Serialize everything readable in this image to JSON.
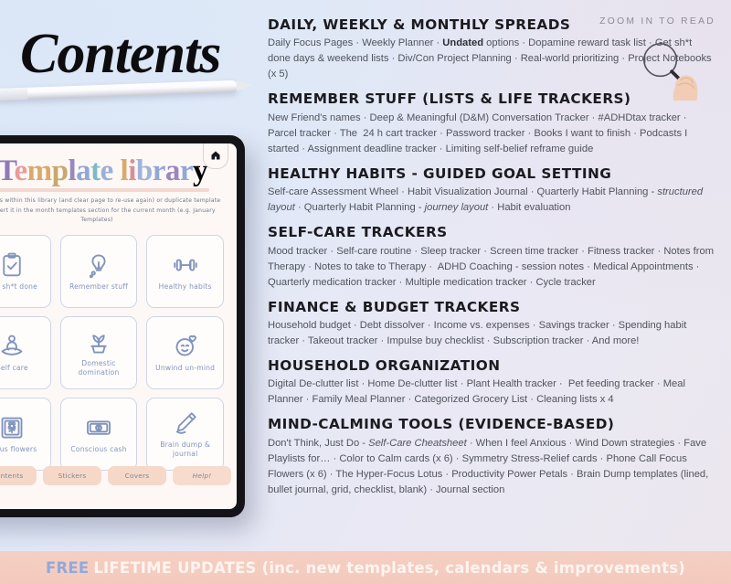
{
  "hero": {
    "title": "Contents"
  },
  "zoom_hint": "ZOOM IN TO READ",
  "tablet": {
    "home_icon": "home-icon",
    "library_title": "Template library",
    "library_title_letters": [
      "T",
      "e",
      "m",
      "p",
      "l",
      "a",
      "t",
      "e",
      " ",
      "l",
      "i",
      "b",
      "r",
      "a",
      "r",
      "y"
    ],
    "description": "templates within this library (and clear page to re-use again) or duplicate template and insert it in the month templates section for the current month (e.g. January Templates)",
    "cards": [
      {
        "label": "Get sh*t done",
        "icon": "clipboard-check-icon"
      },
      {
        "label": "Remember stuff",
        "icon": "lightbulb-thought-icon"
      },
      {
        "label": "Healthy habits",
        "icon": "dumbbell-icon"
      },
      {
        "label": "Self care",
        "icon": "meditation-icon"
      },
      {
        "label": "Domestic domination",
        "icon": "potted-plant-icon"
      },
      {
        "label": "Unwind un-mind",
        "icon": "smiley-heart-icon"
      },
      {
        "label": "Focus flowers",
        "icon": "framed-flower-icon"
      },
      {
        "label": "Conscious cash",
        "icon": "banknote-icon"
      },
      {
        "label": "Brain dump & journal",
        "icon": "pencil-icon"
      }
    ],
    "nav_buttons": [
      {
        "label": "Contents"
      },
      {
        "label": "Stickers"
      },
      {
        "label": "Covers"
      },
      {
        "label": "Help!"
      }
    ]
  },
  "sections": [
    {
      "heading": "DAILY, WEEKLY & MONTHLY SPREADS",
      "body_html": "Daily Focus Pages · Weekly Planner · <b>Undated</b> options · Dopamine reward task list · Get sh*t done days &amp; weekend lists · Div/Con Project Planning · Real-world prioritizing · Project Notebooks (x 5)"
    },
    {
      "heading": "REMEMBER STUFF (LISTS & LIFE TRACKERS)",
      "body_html": "New Friend's names · Deep &amp; Meaningful (D&amp;M) Conversation Tracker · #ADHDtax tracker · Parcel tracker · The&nbsp; 24 h cart tracker · Password tracker · Books I want to finish · Podcasts I started · Assignment deadline tracker · Limiting self-belief reframe guide"
    },
    {
      "heading": "HEALTHY HABITS - GUIDED GOAL SETTING",
      "body_html": "Self-care Assessment Wheel · Habit Visualization Journal · Quarterly Habit Planning - <i>structured layout</i> · Quarterly Habit Planning - <i>journey layout</i> · Habit evaluation"
    },
    {
      "heading": "SELF-CARE TRACKERS",
      "body_html": "Mood tracker · Self-care routine · Sleep tracker · Screen time tracker · Fitness tracker · Notes from Therapy · Notes to take to Therapy ·&nbsp; ADHD Coaching - session notes · Medical Appointments · Quarterly medication tracker · Multiple medication tracker · Cycle tracker"
    },
    {
      "heading": "FINANCE & BUDGET TRACKERS",
      "body_html": "Household budget · Debt dissolver · Income vs. expenses · Savings tracker · Spending habit tracker · Takeout tracker · Impulse buy checklist · Subscription tracker · And more!"
    },
    {
      "heading": "HOUSEHOLD ORGANIZATION",
      "body_html": "Digital De-clutter list · Home De-clutter list · Plant Health tracker ·&nbsp; Pet feeding tracker · Meal Planner · Family Meal Planner · Categorized Grocery List · Cleaning lists x 4"
    },
    {
      "heading": "MIND-CALMING TOOLS (EVIDENCE-BASED)",
      "body_html": "Don't Think, Just Do - <i>Self-Care Cheatsheet</i> · When I feel Anxious · Wind Down strategies · Fave Playlists for… · Color to Calm cards (x 6) · Symmetry Stress-Relief cards · Phone Call Focus Flowers (x 6) · The Hyper-Focus Lotus · Productivity Power Petals · Brain Dump templates (lined, bullet journal, grid, checklist, blank) · Journal section"
    }
  ],
  "banner": {
    "free_label": "FREE",
    "rest_label": "LIFETIME UPDATES (inc. new templates, calendars & improvements)"
  },
  "colors": {
    "banner_bg": "#f4ccc0",
    "banner_free": "#8fa9de",
    "banner_text": "#fdf4ef",
    "card_stroke": "#8094bd",
    "pill_bg": "#f6d8c9",
    "heading": "#1b1b1f",
    "body_text": "#50545c"
  }
}
